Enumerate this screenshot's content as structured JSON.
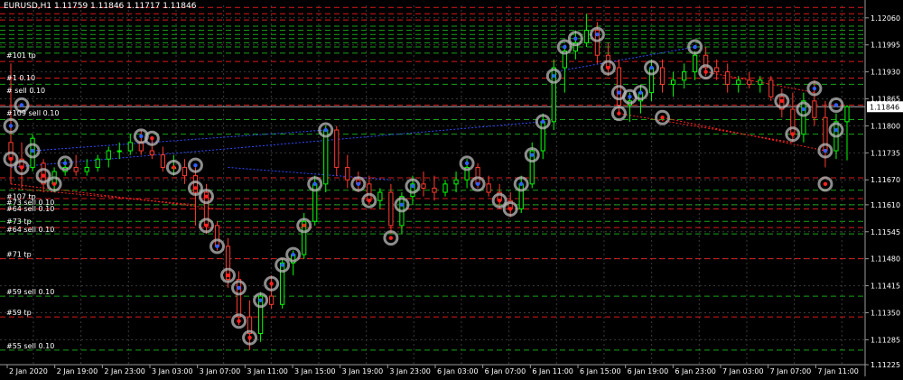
{
  "header": {
    "title": "EURUSD,H1 1.11759 1.11846 1.11717 1.11846"
  },
  "colors": {
    "background": "#000000",
    "up_candle": "#00ff00",
    "down_candle": "#ff3b30",
    "grid": "#3a3a3a",
    "axis_text": "#ffffff",
    "current_price_bg": "#ffffff",
    "level_red": "#ff2020",
    "level_green": "#1fbf1f",
    "trend_red": "#ff2020",
    "trend_blue": "#2f4bff",
    "marker_ring": "#bbbbbb"
  },
  "chart_data": {
    "type": "candlestick",
    "symbol": "EURUSD",
    "timeframe": "H1",
    "ylim": [
      1.11225,
      1.1209
    ],
    "y_ticks": [
      "1.12060",
      "1.11995",
      "1.11930",
      "1.11865",
      "1.11800",
      "1.11735",
      "1.11670",
      "1.11610",
      "1.11545",
      "1.11480",
      "1.11415",
      "1.11350",
      "1.11285",
      "1.11225"
    ],
    "current_price": "1.11846",
    "x_ticks": [
      "2 Jan 2020",
      "2 Jan 19:00",
      "2 Jan 23:00",
      "3 Jan 03:00",
      "3 Jan 07:00",
      "3 Jan 11:00",
      "3 Jan 15:00",
      "3 Jan 19:00",
      "3 Jan 23:00",
      "6 Jan 03:00",
      "6 Jan 07:00",
      "6 Jan 11:00",
      "6 Jan 15:00",
      "6 Jan 19:00",
      "6 Jan 23:00",
      "7 Jan 03:00",
      "7 Jan 07:00",
      "7 Jan 11:00"
    ],
    "candles": [
      [
        1.1176,
        1.1195,
        1.1166,
        1.1172
      ],
      [
        1.1172,
        1.1176,
        1.1165,
        1.117
      ],
      [
        1.117,
        1.1178,
        1.1169,
        1.1177
      ],
      [
        1.1171,
        1.1172,
        1.1164,
        1.1166
      ],
      [
        1.1166,
        1.117,
        1.1164,
        1.1169
      ],
      [
        1.1169,
        1.1172,
        1.1168,
        1.117
      ],
      [
        1.117,
        1.1173,
        1.1168,
        1.1169
      ],
      [
        1.1169,
        1.1172,
        1.1168,
        1.117
      ],
      [
        1.117,
        1.1173,
        1.1169,
        1.1172
      ],
      [
        1.1172,
        1.1175,
        1.117,
        1.1174
      ],
      [
        1.1174,
        1.1176,
        1.1172,
        1.1174
      ],
      [
        1.1174,
        1.1178,
        1.1173,
        1.1176
      ],
      [
        1.1176,
        1.1179,
        1.1173,
        1.1174
      ],
      [
        1.1174,
        1.1177,
        1.1172,
        1.1173
      ],
      [
        1.1173,
        1.1175,
        1.1169,
        1.117
      ],
      [
        1.117,
        1.1173,
        1.1168,
        1.117
      ],
      [
        1.117,
        1.1172,
        1.1166,
        1.1168
      ],
      [
        1.1168,
        1.117,
        1.1156,
        1.1164
      ],
      [
        1.1164,
        1.1166,
        1.1154,
        1.1156
      ],
      [
        1.1156,
        1.1157,
        1.115,
        1.1151
      ],
      [
        1.1151,
        1.1153,
        1.1141,
        1.1143
      ],
      [
        1.1143,
        1.1145,
        1.1132,
        1.1134
      ],
      [
        1.1134,
        1.1138,
        1.1126,
        1.113
      ],
      [
        1.113,
        1.114,
        1.1128,
        1.1139
      ],
      [
        1.1139,
        1.1144,
        1.1136,
        1.1137
      ],
      [
        1.1137,
        1.1148,
        1.1136,
        1.1147
      ],
      [
        1.1147,
        1.115,
        1.1144,
        1.1149
      ],
      [
        1.1149,
        1.1159,
        1.1148,
        1.1157
      ],
      [
        1.1157,
        1.1168,
        1.1156,
        1.1166
      ],
      [
        1.1166,
        1.118,
        1.1164,
        1.1179
      ],
      [
        1.1179,
        1.118,
        1.1168,
        1.117
      ],
      [
        1.117,
        1.1173,
        1.1165,
        1.1167
      ],
      [
        1.1167,
        1.1169,
        1.1164,
        1.1166
      ],
      [
        1.1166,
        1.1168,
        1.1161,
        1.1162
      ],
      [
        1.1162,
        1.1165,
        1.116,
        1.1164
      ],
      [
        1.1164,
        1.1166,
        1.1154,
        1.1156
      ],
      [
        1.1156,
        1.1164,
        1.1154,
        1.1163
      ],
      [
        1.1163,
        1.1168,
        1.1161,
        1.1166
      ],
      [
        1.1166,
        1.1169,
        1.1163,
        1.1165
      ],
      [
        1.1165,
        1.1168,
        1.1162,
        1.1164
      ],
      [
        1.1164,
        1.1167,
        1.1163,
        1.1166
      ],
      [
        1.1166,
        1.1169,
        1.1164,
        1.1167
      ],
      [
        1.1167,
        1.1172,
        1.1165,
        1.117
      ],
      [
        1.117,
        1.1171,
        1.1165,
        1.1166
      ],
      [
        1.1166,
        1.1168,
        1.1163,
        1.1164
      ],
      [
        1.1164,
        1.1166,
        1.116,
        1.1162
      ],
      [
        1.1162,
        1.1164,
        1.1158,
        1.116
      ],
      [
        1.116,
        1.1168,
        1.1159,
        1.1166
      ],
      [
        1.1166,
        1.1176,
        1.1165,
        1.1174
      ],
      [
        1.1174,
        1.1183,
        1.1172,
        1.1181
      ],
      [
        1.1181,
        1.1196,
        1.1179,
        1.1194
      ],
      [
        1.1194,
        1.1199,
        1.1188,
        1.1198
      ],
      [
        1.1198,
        1.1203,
        1.1196,
        1.12
      ],
      [
        1.12,
        1.1207,
        1.1199,
        1.1203
      ],
      [
        1.1203,
        1.1205,
        1.1195,
        1.1197
      ],
      [
        1.1197,
        1.12,
        1.1192,
        1.1194
      ],
      [
        1.1194,
        1.1196,
        1.1183,
        1.1185
      ],
      [
        1.1185,
        1.1188,
        1.1181,
        1.1186
      ],
      [
        1.1186,
        1.119,
        1.1183,
        1.1188
      ],
      [
        1.1188,
        1.1196,
        1.1186,
        1.1194
      ],
      [
        1.1194,
        1.1196,
        1.1188,
        1.119
      ],
      [
        1.119,
        1.1193,
        1.1187,
        1.1191
      ],
      [
        1.1191,
        1.1195,
        1.1189,
        1.1193
      ],
      [
        1.1193,
        1.1198,
        1.1191,
        1.1197
      ],
      [
        1.1197,
        1.1199,
        1.1192,
        1.1194
      ],
      [
        1.1194,
        1.1196,
        1.1191,
        1.1193
      ],
      [
        1.1193,
        1.1195,
        1.1188,
        1.119
      ],
      [
        1.119,
        1.1192,
        1.1188,
        1.1191
      ],
      [
        1.1191,
        1.1193,
        1.1189,
        1.119
      ],
      [
        1.119,
        1.1192,
        1.1188,
        1.1191
      ],
      [
        1.1191,
        1.1192,
        1.1186,
        1.1187
      ],
      [
        1.1187,
        1.1189,
        1.1182,
        1.1184
      ],
      [
        1.1184,
        1.1188,
        1.1176,
        1.1178
      ],
      [
        1.1178,
        1.1188,
        1.1176,
        1.1186
      ],
      [
        1.1186,
        1.1191,
        1.118,
        1.1182
      ],
      [
        1.1182,
        1.1186,
        1.117,
        1.1174
      ],
      [
        1.1174,
        1.1183,
        1.1172,
        1.1181
      ],
      [
        1.1181,
        1.1185,
        1.11717,
        1.11846
      ]
    ],
    "levels": [
      {
        "price": 1.12085,
        "color": "red"
      },
      {
        "price": 1.1207,
        "color": "red"
      },
      {
        "price": 1.12055,
        "color": "red"
      },
      {
        "price": 1.1204,
        "color": "green"
      },
      {
        "price": 1.1203,
        "color": "green"
      },
      {
        "price": 1.1202,
        "color": "green"
      },
      {
        "price": 1.1201,
        "color": "green"
      },
      {
        "price": 1.12,
        "color": "green"
      },
      {
        "price": 1.1199,
        "color": "green"
      },
      {
        "price": 1.11975,
        "color": "green"
      },
      {
        "price": 1.11955,
        "color": "red"
      },
      {
        "price": 1.11915,
        "color": "red"
      },
      {
        "price": 1.119,
        "color": "green"
      },
      {
        "price": 1.1185,
        "color": "red"
      },
      {
        "price": 1.11815,
        "color": "green"
      },
      {
        "price": 1.1178,
        "color": "green"
      },
      {
        "price": 1.11675,
        "color": "red"
      },
      {
        "price": 1.11645,
        "color": "green"
      },
      {
        "price": 1.11625,
        "color": "red"
      },
      {
        "price": 1.1161,
        "color": "green"
      },
      {
        "price": 1.116,
        "color": "red"
      },
      {
        "price": 1.1157,
        "color": "green"
      },
      {
        "price": 1.11555,
        "color": "red"
      },
      {
        "price": 1.1154,
        "color": "green"
      },
      {
        "price": 1.1148,
        "color": "red"
      },
      {
        "price": 1.1139,
        "color": "green"
      },
      {
        "price": 1.1134,
        "color": "red"
      },
      {
        "price": 1.1126,
        "color": "green"
      }
    ],
    "annotations": [
      {
        "text": "#101 tp",
        "price": 1.1196
      },
      {
        "text": "#1 0.10",
        "price": 1.11905
      },
      {
        "text": "# sell 0.10",
        "price": 1.11875
      },
      {
        "text": "#109 sell 0.10",
        "price": 1.1182
      },
      {
        "text": "#107 tp",
        "price": 1.1162
      },
      {
        "text": "#73 sell 0.10",
        "price": 1.11605
      },
      {
        "text": "#64 sell 0.10",
        "price": 1.1159
      },
      {
        "text": "#73 tp",
        "price": 1.1156
      },
      {
        "text": "#64 sell 0.10",
        "price": 1.1154
      },
      {
        "text": "#71 tp",
        "price": 1.1148
      },
      {
        "text": "#59 sell 0.10",
        "price": 1.1139
      },
      {
        "text": "#59 tp",
        "price": 1.1134
      },
      {
        "text": "#55 sell 0.10",
        "price": 1.1126
      }
    ],
    "markers": [
      {
        "i": 0,
        "p": 1.1172,
        "t": "sell"
      },
      {
        "i": 0,
        "p": 1.118,
        "t": "buy"
      },
      {
        "i": 1,
        "p": 1.117,
        "t": "sell"
      },
      {
        "i": 1,
        "p": 1.1185,
        "t": "buy"
      },
      {
        "i": 2,
        "p": 1.1174,
        "t": "buy"
      },
      {
        "i": 3,
        "p": 1.1168,
        "t": "sell"
      },
      {
        "i": 4,
        "p": 1.1166,
        "t": "sell"
      },
      {
        "i": 5,
        "p": 1.1171,
        "t": "buy"
      },
      {
        "i": 12,
        "p": 1.11775,
        "t": "buy"
      },
      {
        "i": 13,
        "p": 1.1177,
        "t": "sell"
      },
      {
        "i": 15,
        "p": 1.117,
        "t": "sell"
      },
      {
        "i": 17,
        "p": 1.11705,
        "t": "buy"
      },
      {
        "i": 17,
        "p": 1.1165,
        "t": "sell"
      },
      {
        "i": 18,
        "p": 1.1163,
        "t": "sell"
      },
      {
        "i": 18,
        "p": 1.1156,
        "t": "sell"
      },
      {
        "i": 19,
        "p": 1.1151,
        "t": "buy"
      },
      {
        "i": 20,
        "p": 1.1144,
        "t": "sell"
      },
      {
        "i": 21,
        "p": 1.1141,
        "t": "buy"
      },
      {
        "i": 21,
        "p": 1.1133,
        "t": "sell"
      },
      {
        "i": 22,
        "p": 1.1129,
        "t": "sell"
      },
      {
        "i": 23,
        "p": 1.1138,
        "t": "buy"
      },
      {
        "i": 24,
        "p": 1.1142,
        "t": "sell"
      },
      {
        "i": 25,
        "p": 1.11465,
        "t": "buy"
      },
      {
        "i": 26,
        "p": 1.1149,
        "t": "buy"
      },
      {
        "i": 27,
        "p": 1.1156,
        "t": "sell"
      },
      {
        "i": 28,
        "p": 1.1166,
        "t": "buy"
      },
      {
        "i": 29,
        "p": 1.1179,
        "t": "buy"
      },
      {
        "i": 32,
        "p": 1.1166,
        "t": "buy"
      },
      {
        "i": 33,
        "p": 1.1162,
        "t": "sell"
      },
      {
        "i": 35,
        "p": 1.1153,
        "t": "sell"
      },
      {
        "i": 36,
        "p": 1.1161,
        "t": "buy"
      },
      {
        "i": 37,
        "p": 1.11655,
        "t": "buy"
      },
      {
        "i": 42,
        "p": 1.1171,
        "t": "buy"
      },
      {
        "i": 43,
        "p": 1.1166,
        "t": "buy"
      },
      {
        "i": 45,
        "p": 1.1162,
        "t": "sell"
      },
      {
        "i": 46,
        "p": 1.116,
        "t": "sell"
      },
      {
        "i": 47,
        "p": 1.1166,
        "t": "buy"
      },
      {
        "i": 48,
        "p": 1.1173,
        "t": "buy"
      },
      {
        "i": 49,
        "p": 1.1181,
        "t": "buy"
      },
      {
        "i": 50,
        "p": 1.1192,
        "t": "buy"
      },
      {
        "i": 51,
        "p": 1.1199,
        "t": "buy"
      },
      {
        "i": 52,
        "p": 1.1201,
        "t": "buy"
      },
      {
        "i": 54,
        "p": 1.1202,
        "t": "buy"
      },
      {
        "i": 55,
        "p": 1.1194,
        "t": "sell"
      },
      {
        "i": 56,
        "p": 1.1183,
        "t": "sell"
      },
      {
        "i": 57,
        "p": 1.1187,
        "t": "buy"
      },
      {
        "i": 58,
        "p": 1.1188,
        "t": "buy"
      },
      {
        "i": 59,
        "p": 1.1194,
        "t": "buy"
      },
      {
        "i": 56,
        "p": 1.1188,
        "t": "buy"
      },
      {
        "i": 60,
        "p": 1.1182,
        "t": "sell"
      },
      {
        "i": 63,
        "p": 1.1199,
        "t": "buy"
      },
      {
        "i": 64,
        "p": 1.1193,
        "t": "sell"
      },
      {
        "i": 71,
        "p": 1.1186,
        "t": "sell"
      },
      {
        "i": 72,
        "p": 1.1178,
        "t": "sell"
      },
      {
        "i": 73,
        "p": 1.1184,
        "t": "buy"
      },
      {
        "i": 74,
        "p": 1.1189,
        "t": "buy"
      },
      {
        "i": 75,
        "p": 1.1174,
        "t": "buy"
      },
      {
        "i": 75,
        "p": 1.1166,
        "t": "sell"
      },
      {
        "i": 76,
        "p": 1.1185,
        "t": "buy"
      },
      {
        "i": 76,
        "p": 1.1179,
        "t": "buy"
      }
    ],
    "trend_lines": [
      {
        "i0": 0,
        "p0": 1.1166,
        "i1": 19,
        "p1": 1.116,
        "color": "red"
      },
      {
        "i0": 0,
        "p0": 1.1165,
        "i1": 17,
        "p1": 1.1161,
        "color": "red"
      },
      {
        "i0": 2,
        "p0": 1.1174,
        "i1": 29,
        "p1": 1.1179,
        "color": "blue"
      },
      {
        "i0": 0,
        "p0": 1.117,
        "i1": 49,
        "p1": 1.1181,
        "color": "blue"
      },
      {
        "i0": 20,
        "p0": 1.117,
        "i1": 35,
        "p1": 1.1167,
        "color": "blue"
      },
      {
        "i0": 50,
        "p0": 1.1193,
        "i1": 63,
        "p1": 1.1199,
        "color": "blue"
      },
      {
        "i0": 56,
        "p0": 1.1183,
        "i1": 72,
        "p1": 1.1176,
        "color": "red"
      },
      {
        "i0": 60,
        "p0": 1.1182,
        "i1": 75,
        "p1": 1.1174,
        "color": "red"
      },
      {
        "i0": 64,
        "p0": 1.1193,
        "i1": 74,
        "p1": 1.1188,
        "color": "red"
      }
    ]
  }
}
